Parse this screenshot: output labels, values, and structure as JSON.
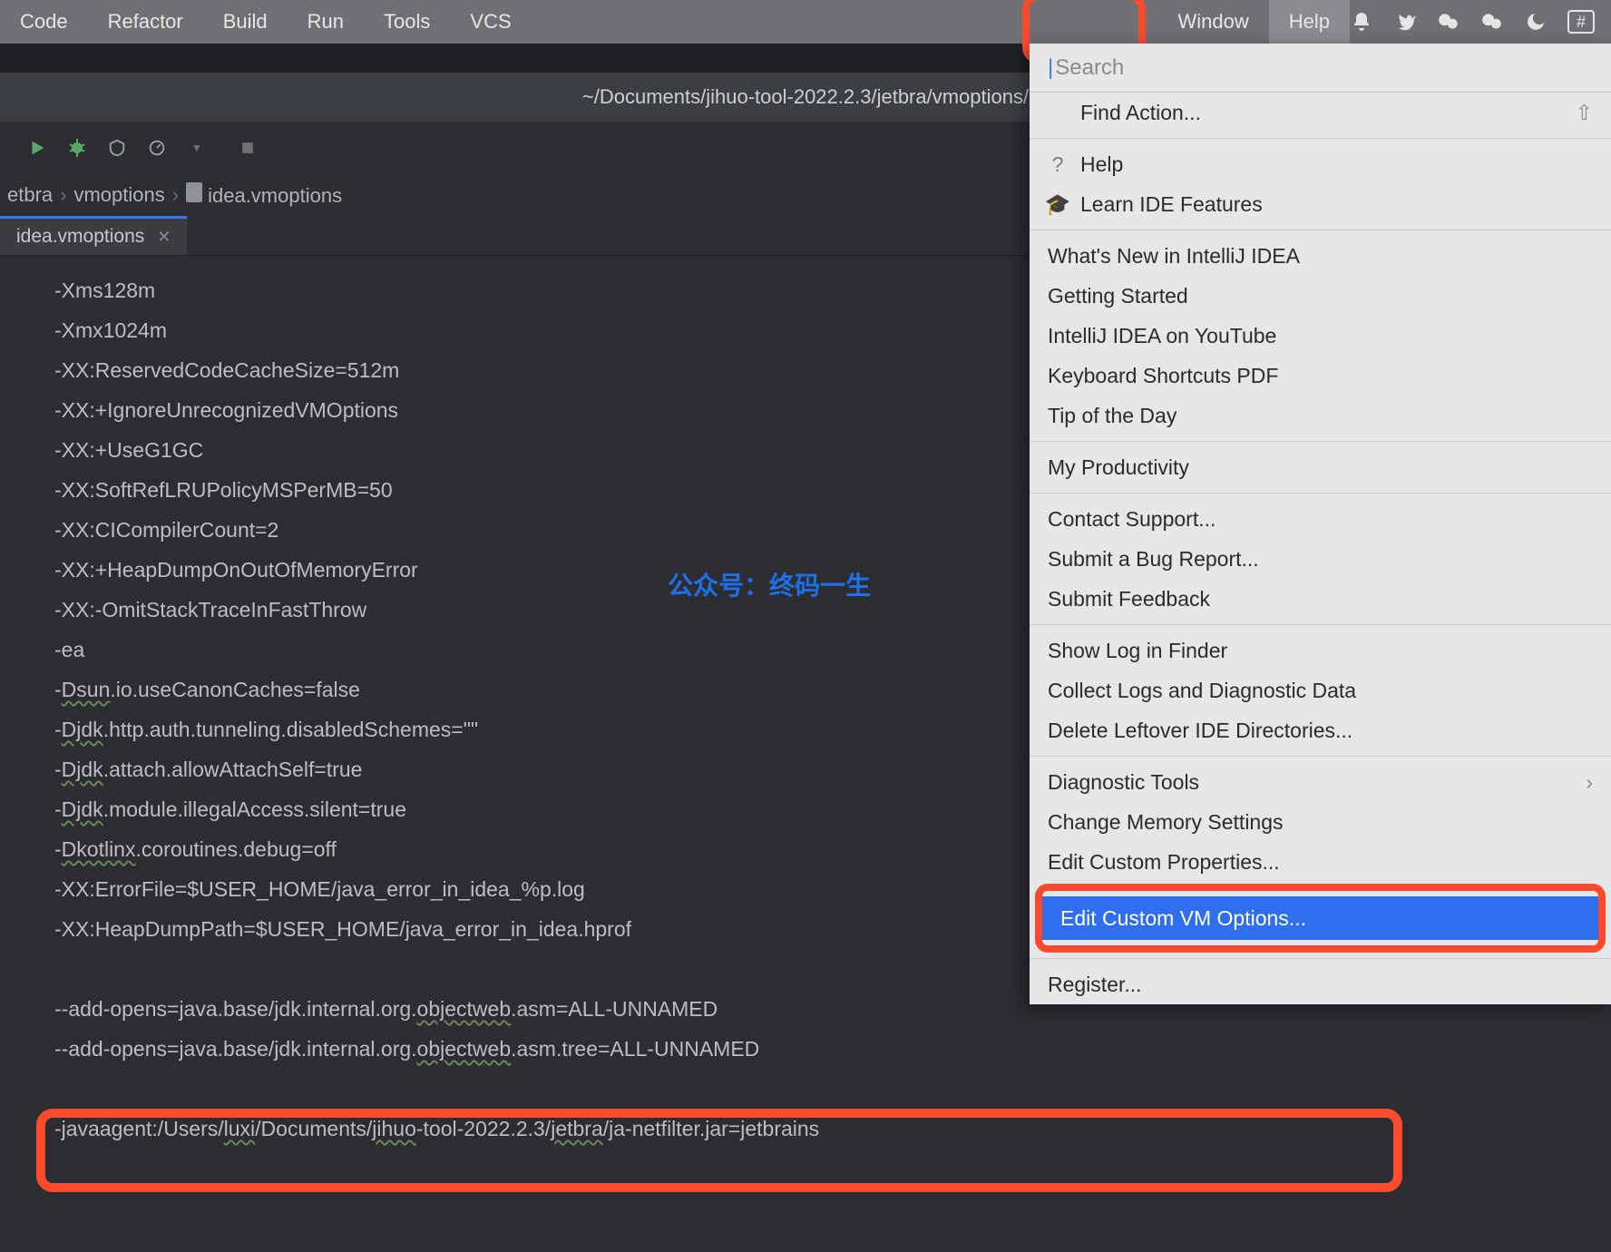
{
  "menubar": {
    "items": [
      "Code",
      "Refactor",
      "Build",
      "Run",
      "Tools",
      "VCS"
    ],
    "right_items": [
      "Window",
      "Help"
    ]
  },
  "pathbar": {
    "text": "~/Documents/jihuo-tool-2022.2.3/jetbra/vmoptions/"
  },
  "breadcrumb": {
    "items": [
      "etbra",
      "vmoptions",
      "idea.vmoptions"
    ]
  },
  "tab": {
    "label": "idea.vmoptions"
  },
  "watermark": "公众号：终码一生",
  "editor_lines": [
    {
      "text": "-Xms128m"
    },
    {
      "text": "-Xmx1024m"
    },
    {
      "text": "-XX:ReservedCodeCacheSize=512m"
    },
    {
      "text": "-XX:+IgnoreUnrecognizedVMOptions"
    },
    {
      "text": "-XX:+UseG1GC"
    },
    {
      "text": "-XX:SoftRefLRUPolicyMSPerMB=50"
    },
    {
      "text": "-XX:CICompilerCount=2"
    },
    {
      "text": "-XX:+HeapDumpOnOutOfMemoryError"
    },
    {
      "text": "-XX:-OmitStackTraceInFastThrow"
    },
    {
      "text": "-ea"
    },
    {
      "prefix": "-",
      "wavy": "Dsun",
      "suffix": ".io.useCanonCaches=false"
    },
    {
      "prefix": "-",
      "wavy": "Djdk",
      "suffix": ".http.auth.tunneling.disabledSchemes=\"\""
    },
    {
      "prefix": "-",
      "wavy": "Djdk",
      "suffix": ".attach.allowAttachSelf=true"
    },
    {
      "prefix": "-",
      "wavy": "Djdk",
      "suffix": ".module.illegalAccess.silent=true"
    },
    {
      "prefix": "-",
      "wavy": "Dkotlinx",
      "suffix": ".coroutines.debug=off"
    },
    {
      "text": "-XX:ErrorFile=$USER_HOME/java_error_in_idea_%p.log"
    },
    {
      "text": "-XX:HeapDumpPath=$USER_HOME/java_error_in_idea.hprof"
    },
    {
      "text": ""
    },
    {
      "prefix": "--add-opens=java.base/jdk.internal.org.",
      "wavy": "objectweb",
      "suffix": ".asm=ALL-UNNAMED"
    },
    {
      "prefix": "--add-opens=java.base/jdk.internal.org.",
      "wavy": "objectweb",
      "suffix": ".asm.tree=ALL-UNNAMED"
    },
    {
      "text": ""
    },
    {
      "parts": [
        {
          "t": "-javaagent:/Users/"
        },
        {
          "t": "luxi",
          "w": true
        },
        {
          "t": "/Documents/"
        },
        {
          "t": "jihuo",
          "w": true
        },
        {
          "t": "-tool-2022.2.3/"
        },
        {
          "t": "jetbra",
          "w": true
        },
        {
          "t": "/ja-netfilter.jar=jetbrains"
        }
      ]
    }
  ],
  "dropdown": {
    "search_placeholder": "Search",
    "groups": [
      [
        {
          "label": "Find Action...",
          "icon": "",
          "shortcut": "⇧"
        }
      ],
      [
        {
          "label": "Help",
          "icon": "?"
        },
        {
          "label": "Learn IDE Features",
          "icon": "🎓"
        }
      ],
      [
        {
          "label": "What's New in IntelliJ IDEA"
        },
        {
          "label": "Getting Started"
        },
        {
          "label": "IntelliJ IDEA on YouTube"
        },
        {
          "label": "Keyboard Shortcuts PDF"
        },
        {
          "label": "Tip of the Day"
        }
      ],
      [
        {
          "label": "My Productivity"
        }
      ],
      [
        {
          "label": "Contact Support..."
        },
        {
          "label": "Submit a Bug Report..."
        },
        {
          "label": "Submit Feedback"
        }
      ],
      [
        {
          "label": "Show Log in Finder"
        },
        {
          "label": "Collect Logs and Diagnostic Data"
        },
        {
          "label": "Delete Leftover IDE Directories..."
        }
      ],
      [
        {
          "label": "Diagnostic Tools",
          "submenu": true
        },
        {
          "label": "Change Memory Settings"
        },
        {
          "label": "Edit Custom Properties..."
        },
        {
          "label": "Edit Custom VM Options...",
          "selected": true
        }
      ],
      [
        {
          "label": "Register..."
        }
      ]
    ]
  }
}
